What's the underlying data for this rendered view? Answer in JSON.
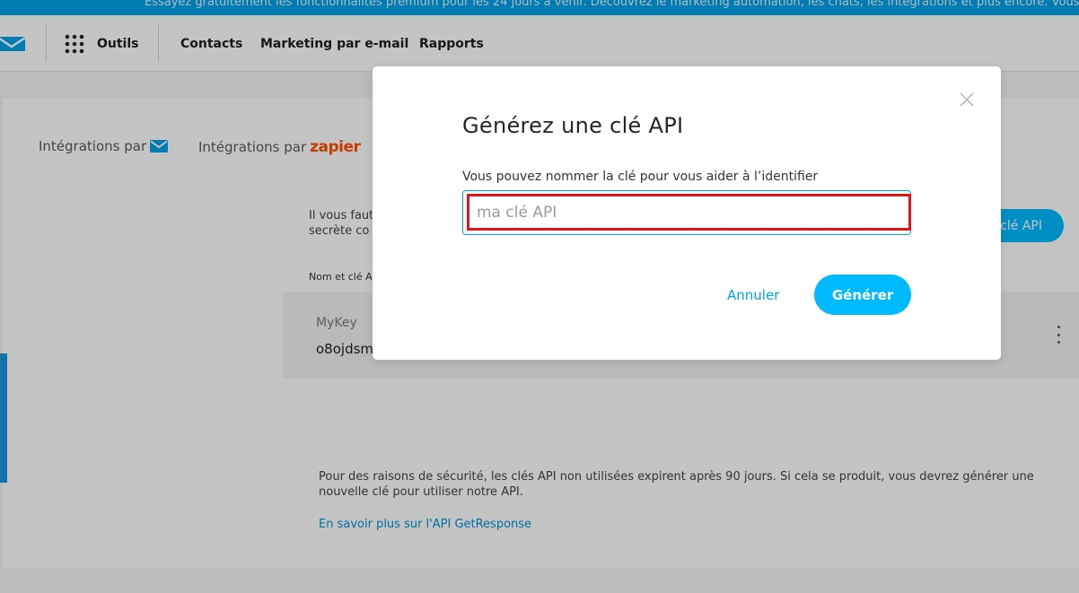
{
  "promo_banner": {
    "text": "Essayez gratuitement les fonctionnalités premium pour les 24 jours à venir. Découvrez le marketing automation, les chats, les intégrations et plus encore. Vous aimez ce que"
  },
  "nav": {
    "tools_label": "Outils",
    "links": [
      "Contacts",
      "Marketing par e-mail",
      "Rapports"
    ]
  },
  "integrations": {
    "tab_getresponse": "Intégrations par",
    "tab_zapier": "Intégrations par",
    "zapier_brand": "zapier"
  },
  "main": {
    "info_line1": "Il vous faut",
    "info_line2": "secrète co",
    "generate_button_partial": "clé API",
    "keys_header": "Nom et clé A",
    "key_name": "MyKey",
    "key_value": "o8ojdsm",
    "security_note": "Pour des raisons de sécurité, les clés API non utilisées expirent après 90 jours. Si cela se produit, vous devrez générer une nouvelle clé pour utiliser notre API.",
    "learn_more_link": "En savoir plus sur l'API GetResponse"
  },
  "modal": {
    "title": "Générez une clé API",
    "field_label": "Vous pouvez nommer la clé pour vous aider à l’identifier",
    "input_placeholder": "ma clé API",
    "input_value": "",
    "cancel_label": "Annuler",
    "submit_label": "Générer"
  },
  "colors": {
    "accent": "#00baff",
    "link": "#00a2e8",
    "highlight": "#e3141c",
    "zapier": "#ff4f00"
  },
  "icons": [
    "envelope-logo-icon",
    "apps-grid-icon",
    "close-icon",
    "kebab-menu-icon"
  ]
}
